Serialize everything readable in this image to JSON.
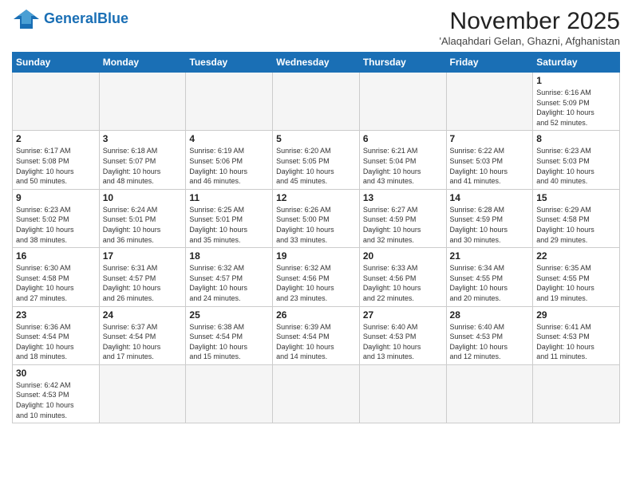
{
  "header": {
    "logo_general": "General",
    "logo_blue": "Blue",
    "title": "November 2025",
    "subtitle": "'Alaqahdari Gelan, Ghazni, Afghanistan"
  },
  "days_of_week": [
    "Sunday",
    "Monday",
    "Tuesday",
    "Wednesday",
    "Thursday",
    "Friday",
    "Saturday"
  ],
  "weeks": [
    [
      {
        "day": "",
        "info": ""
      },
      {
        "day": "",
        "info": ""
      },
      {
        "day": "",
        "info": ""
      },
      {
        "day": "",
        "info": ""
      },
      {
        "day": "",
        "info": ""
      },
      {
        "day": "",
        "info": ""
      },
      {
        "day": "1",
        "info": "Sunrise: 6:16 AM\nSunset: 5:09 PM\nDaylight: 10 hours\nand 52 minutes."
      }
    ],
    [
      {
        "day": "2",
        "info": "Sunrise: 6:17 AM\nSunset: 5:08 PM\nDaylight: 10 hours\nand 50 minutes."
      },
      {
        "day": "3",
        "info": "Sunrise: 6:18 AM\nSunset: 5:07 PM\nDaylight: 10 hours\nand 48 minutes."
      },
      {
        "day": "4",
        "info": "Sunrise: 6:19 AM\nSunset: 5:06 PM\nDaylight: 10 hours\nand 46 minutes."
      },
      {
        "day": "5",
        "info": "Sunrise: 6:20 AM\nSunset: 5:05 PM\nDaylight: 10 hours\nand 45 minutes."
      },
      {
        "day": "6",
        "info": "Sunrise: 6:21 AM\nSunset: 5:04 PM\nDaylight: 10 hours\nand 43 minutes."
      },
      {
        "day": "7",
        "info": "Sunrise: 6:22 AM\nSunset: 5:03 PM\nDaylight: 10 hours\nand 41 minutes."
      },
      {
        "day": "8",
        "info": "Sunrise: 6:23 AM\nSunset: 5:03 PM\nDaylight: 10 hours\nand 40 minutes."
      }
    ],
    [
      {
        "day": "9",
        "info": "Sunrise: 6:23 AM\nSunset: 5:02 PM\nDaylight: 10 hours\nand 38 minutes."
      },
      {
        "day": "10",
        "info": "Sunrise: 6:24 AM\nSunset: 5:01 PM\nDaylight: 10 hours\nand 36 minutes."
      },
      {
        "day": "11",
        "info": "Sunrise: 6:25 AM\nSunset: 5:01 PM\nDaylight: 10 hours\nand 35 minutes."
      },
      {
        "day": "12",
        "info": "Sunrise: 6:26 AM\nSunset: 5:00 PM\nDaylight: 10 hours\nand 33 minutes."
      },
      {
        "day": "13",
        "info": "Sunrise: 6:27 AM\nSunset: 4:59 PM\nDaylight: 10 hours\nand 32 minutes."
      },
      {
        "day": "14",
        "info": "Sunrise: 6:28 AM\nSunset: 4:59 PM\nDaylight: 10 hours\nand 30 minutes."
      },
      {
        "day": "15",
        "info": "Sunrise: 6:29 AM\nSunset: 4:58 PM\nDaylight: 10 hours\nand 29 minutes."
      }
    ],
    [
      {
        "day": "16",
        "info": "Sunrise: 6:30 AM\nSunset: 4:58 PM\nDaylight: 10 hours\nand 27 minutes."
      },
      {
        "day": "17",
        "info": "Sunrise: 6:31 AM\nSunset: 4:57 PM\nDaylight: 10 hours\nand 26 minutes."
      },
      {
        "day": "18",
        "info": "Sunrise: 6:32 AM\nSunset: 4:57 PM\nDaylight: 10 hours\nand 24 minutes."
      },
      {
        "day": "19",
        "info": "Sunrise: 6:32 AM\nSunset: 4:56 PM\nDaylight: 10 hours\nand 23 minutes."
      },
      {
        "day": "20",
        "info": "Sunrise: 6:33 AM\nSunset: 4:56 PM\nDaylight: 10 hours\nand 22 minutes."
      },
      {
        "day": "21",
        "info": "Sunrise: 6:34 AM\nSunset: 4:55 PM\nDaylight: 10 hours\nand 20 minutes."
      },
      {
        "day": "22",
        "info": "Sunrise: 6:35 AM\nSunset: 4:55 PM\nDaylight: 10 hours\nand 19 minutes."
      }
    ],
    [
      {
        "day": "23",
        "info": "Sunrise: 6:36 AM\nSunset: 4:54 PM\nDaylight: 10 hours\nand 18 minutes."
      },
      {
        "day": "24",
        "info": "Sunrise: 6:37 AM\nSunset: 4:54 PM\nDaylight: 10 hours\nand 17 minutes."
      },
      {
        "day": "25",
        "info": "Sunrise: 6:38 AM\nSunset: 4:54 PM\nDaylight: 10 hours\nand 15 minutes."
      },
      {
        "day": "26",
        "info": "Sunrise: 6:39 AM\nSunset: 4:54 PM\nDaylight: 10 hours\nand 14 minutes."
      },
      {
        "day": "27",
        "info": "Sunrise: 6:40 AM\nSunset: 4:53 PM\nDaylight: 10 hours\nand 13 minutes."
      },
      {
        "day": "28",
        "info": "Sunrise: 6:40 AM\nSunset: 4:53 PM\nDaylight: 10 hours\nand 12 minutes."
      },
      {
        "day": "29",
        "info": "Sunrise: 6:41 AM\nSunset: 4:53 PM\nDaylight: 10 hours\nand 11 minutes."
      }
    ],
    [
      {
        "day": "30",
        "info": "Sunrise: 6:42 AM\nSunset: 4:53 PM\nDaylight: 10 hours\nand 10 minutes."
      },
      {
        "day": "",
        "info": ""
      },
      {
        "day": "",
        "info": ""
      },
      {
        "day": "",
        "info": ""
      },
      {
        "day": "",
        "info": ""
      },
      {
        "day": "",
        "info": ""
      },
      {
        "day": "",
        "info": ""
      }
    ]
  ]
}
